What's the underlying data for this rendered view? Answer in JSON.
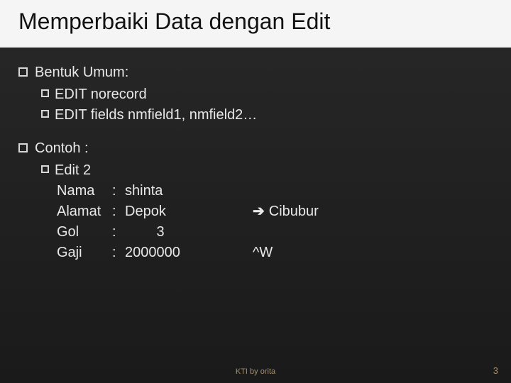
{
  "title": "Memperbaiki Data dengan Edit",
  "sections": [
    {
      "heading": "Bentuk Umum:",
      "items": [
        "EDIT norecord",
        "EDIT fields nmfield1, nmfield2…"
      ]
    },
    {
      "heading": "Contoh :",
      "items": [
        "Edit 2"
      ],
      "example": {
        "rows": [
          {
            "label": "Nama",
            "sep": ":",
            "val": "shinta",
            "ann": ""
          },
          {
            "label": "Alamat",
            "sep": ":",
            "val": "Depok",
            "ann_arrow": "Cibubur"
          },
          {
            "label": "Gol",
            "sep": ":",
            "val": "        3",
            "ann": ""
          },
          {
            "label": "Gaji",
            "sep": ":",
            "val": "2000000",
            "ann": "^W"
          }
        ]
      }
    }
  ],
  "footer_text": "KTI by orita",
  "page_number": "3"
}
